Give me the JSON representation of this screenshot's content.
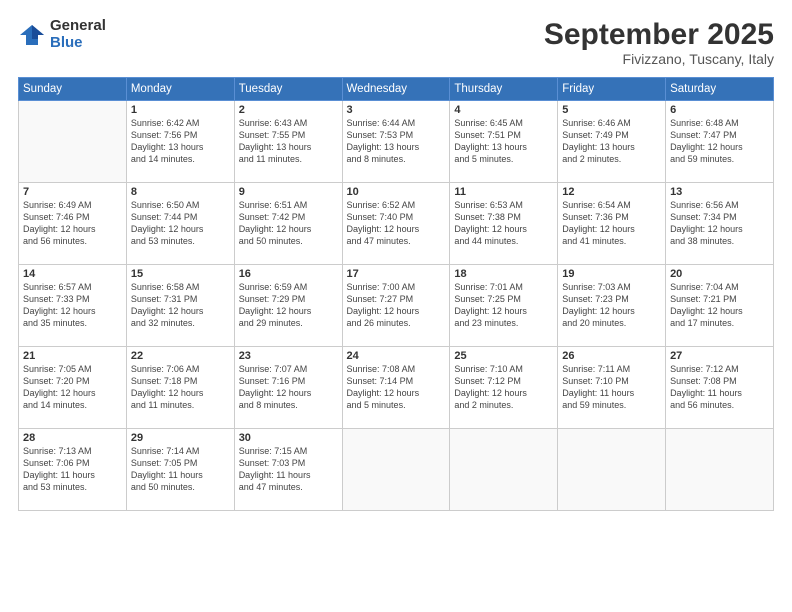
{
  "logo": {
    "general": "General",
    "blue": "Blue"
  },
  "header": {
    "month": "September 2025",
    "location": "Fivizzano, Tuscany, Italy"
  },
  "weekdays": [
    "Sunday",
    "Monday",
    "Tuesday",
    "Wednesday",
    "Thursday",
    "Friday",
    "Saturday"
  ],
  "weeks": [
    [
      {
        "day": "",
        "info": ""
      },
      {
        "day": "1",
        "info": "Sunrise: 6:42 AM\nSunset: 7:56 PM\nDaylight: 13 hours\nand 14 minutes."
      },
      {
        "day": "2",
        "info": "Sunrise: 6:43 AM\nSunset: 7:55 PM\nDaylight: 13 hours\nand 11 minutes."
      },
      {
        "day": "3",
        "info": "Sunrise: 6:44 AM\nSunset: 7:53 PM\nDaylight: 13 hours\nand 8 minutes."
      },
      {
        "day": "4",
        "info": "Sunrise: 6:45 AM\nSunset: 7:51 PM\nDaylight: 13 hours\nand 5 minutes."
      },
      {
        "day": "5",
        "info": "Sunrise: 6:46 AM\nSunset: 7:49 PM\nDaylight: 13 hours\nand 2 minutes."
      },
      {
        "day": "6",
        "info": "Sunrise: 6:48 AM\nSunset: 7:47 PM\nDaylight: 12 hours\nand 59 minutes."
      }
    ],
    [
      {
        "day": "7",
        "info": "Sunrise: 6:49 AM\nSunset: 7:46 PM\nDaylight: 12 hours\nand 56 minutes."
      },
      {
        "day": "8",
        "info": "Sunrise: 6:50 AM\nSunset: 7:44 PM\nDaylight: 12 hours\nand 53 minutes."
      },
      {
        "day": "9",
        "info": "Sunrise: 6:51 AM\nSunset: 7:42 PM\nDaylight: 12 hours\nand 50 minutes."
      },
      {
        "day": "10",
        "info": "Sunrise: 6:52 AM\nSunset: 7:40 PM\nDaylight: 12 hours\nand 47 minutes."
      },
      {
        "day": "11",
        "info": "Sunrise: 6:53 AM\nSunset: 7:38 PM\nDaylight: 12 hours\nand 44 minutes."
      },
      {
        "day": "12",
        "info": "Sunrise: 6:54 AM\nSunset: 7:36 PM\nDaylight: 12 hours\nand 41 minutes."
      },
      {
        "day": "13",
        "info": "Sunrise: 6:56 AM\nSunset: 7:34 PM\nDaylight: 12 hours\nand 38 minutes."
      }
    ],
    [
      {
        "day": "14",
        "info": "Sunrise: 6:57 AM\nSunset: 7:33 PM\nDaylight: 12 hours\nand 35 minutes."
      },
      {
        "day": "15",
        "info": "Sunrise: 6:58 AM\nSunset: 7:31 PM\nDaylight: 12 hours\nand 32 minutes."
      },
      {
        "day": "16",
        "info": "Sunrise: 6:59 AM\nSunset: 7:29 PM\nDaylight: 12 hours\nand 29 minutes."
      },
      {
        "day": "17",
        "info": "Sunrise: 7:00 AM\nSunset: 7:27 PM\nDaylight: 12 hours\nand 26 minutes."
      },
      {
        "day": "18",
        "info": "Sunrise: 7:01 AM\nSunset: 7:25 PM\nDaylight: 12 hours\nand 23 minutes."
      },
      {
        "day": "19",
        "info": "Sunrise: 7:03 AM\nSunset: 7:23 PM\nDaylight: 12 hours\nand 20 minutes."
      },
      {
        "day": "20",
        "info": "Sunrise: 7:04 AM\nSunset: 7:21 PM\nDaylight: 12 hours\nand 17 minutes."
      }
    ],
    [
      {
        "day": "21",
        "info": "Sunrise: 7:05 AM\nSunset: 7:20 PM\nDaylight: 12 hours\nand 14 minutes."
      },
      {
        "day": "22",
        "info": "Sunrise: 7:06 AM\nSunset: 7:18 PM\nDaylight: 12 hours\nand 11 minutes."
      },
      {
        "day": "23",
        "info": "Sunrise: 7:07 AM\nSunset: 7:16 PM\nDaylight: 12 hours\nand 8 minutes."
      },
      {
        "day": "24",
        "info": "Sunrise: 7:08 AM\nSunset: 7:14 PM\nDaylight: 12 hours\nand 5 minutes."
      },
      {
        "day": "25",
        "info": "Sunrise: 7:10 AM\nSunset: 7:12 PM\nDaylight: 12 hours\nand 2 minutes."
      },
      {
        "day": "26",
        "info": "Sunrise: 7:11 AM\nSunset: 7:10 PM\nDaylight: 11 hours\nand 59 minutes."
      },
      {
        "day": "27",
        "info": "Sunrise: 7:12 AM\nSunset: 7:08 PM\nDaylight: 11 hours\nand 56 minutes."
      }
    ],
    [
      {
        "day": "28",
        "info": "Sunrise: 7:13 AM\nSunset: 7:06 PM\nDaylight: 11 hours\nand 53 minutes."
      },
      {
        "day": "29",
        "info": "Sunrise: 7:14 AM\nSunset: 7:05 PM\nDaylight: 11 hours\nand 50 minutes."
      },
      {
        "day": "30",
        "info": "Sunrise: 7:15 AM\nSunset: 7:03 PM\nDaylight: 11 hours\nand 47 minutes."
      },
      {
        "day": "",
        "info": ""
      },
      {
        "day": "",
        "info": ""
      },
      {
        "day": "",
        "info": ""
      },
      {
        "day": "",
        "info": ""
      }
    ]
  ]
}
